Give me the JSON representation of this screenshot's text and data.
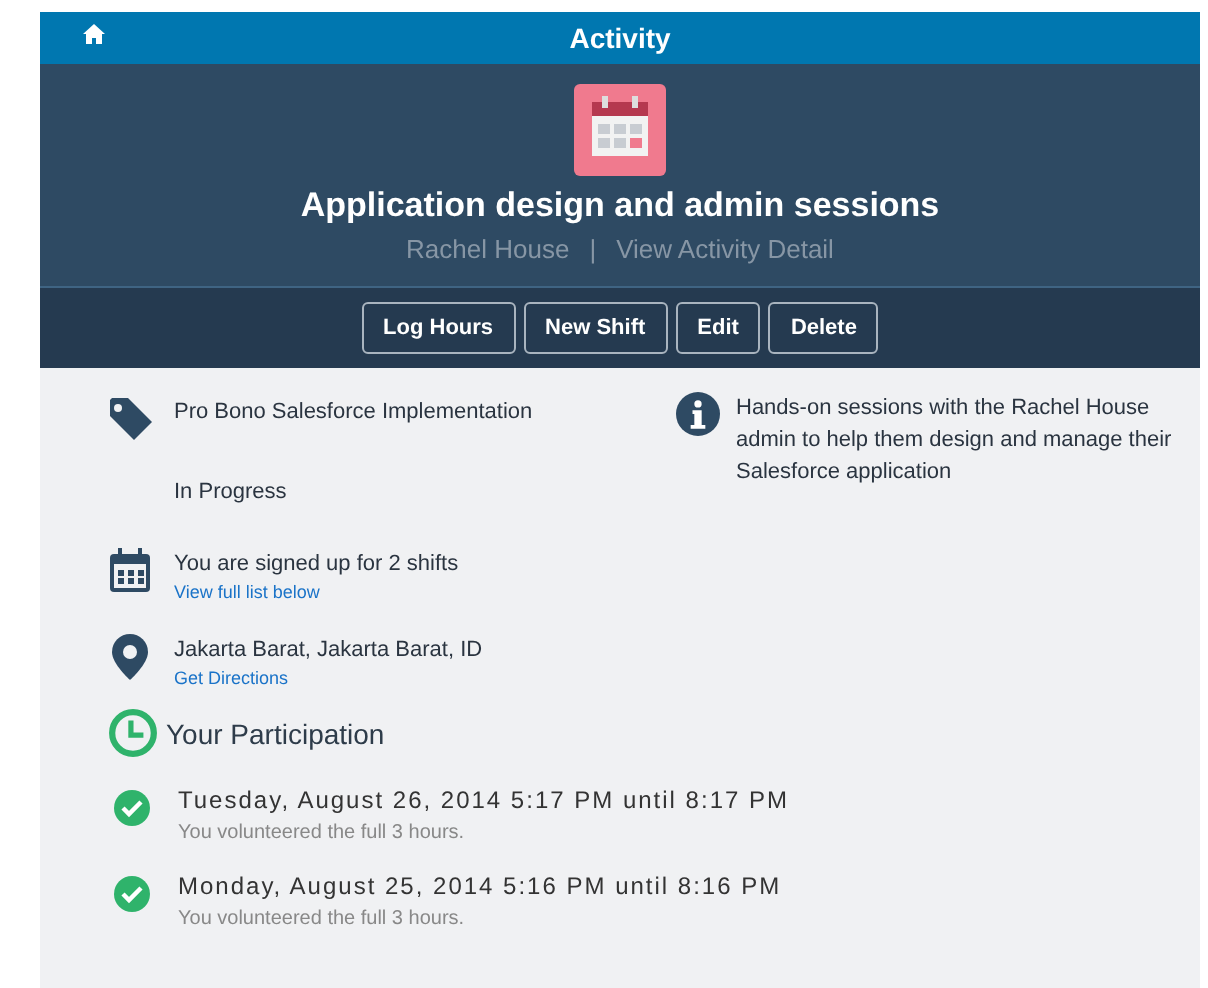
{
  "top_bar": {
    "title": "Activity"
  },
  "header": {
    "title": "Application design and admin sessions",
    "organization": "Rachel House",
    "separator": "|",
    "detail_link": "View Activity Detail"
  },
  "actions": [
    "Log Hours",
    "New Shift",
    "Edit",
    "Delete"
  ],
  "details": [
    {
      "kind": "tag",
      "text": "Pro Bono Salesforce Implementation"
    },
    {
      "kind": "status",
      "text": "In Progress"
    },
    {
      "kind": "calendar",
      "text": "You are signed up for 2 shifts",
      "link": "View full list below"
    },
    {
      "kind": "location",
      "text": "Jakarta Barat, Jakarta Barat, ID",
      "link": "Get Directions"
    }
  ],
  "description": "Hands-on sessions with the Rachel House admin to help them design and manage their Salesforce application",
  "participation": {
    "heading": "Your Participation",
    "shifts": [
      {
        "when": "Tuesday, August 26, 2014 5:17 PM",
        "until": "until",
        "end": "8:17 PM",
        "note": "You volunteered the full 3 hours.",
        "completed": true
      },
      {
        "when": "Monday, August 25, 2014 5:16 PM",
        "until": "until",
        "end": "8:16 PM",
        "note": "You volunteered the full 3 hours.",
        "completed": true
      }
    ]
  }
}
